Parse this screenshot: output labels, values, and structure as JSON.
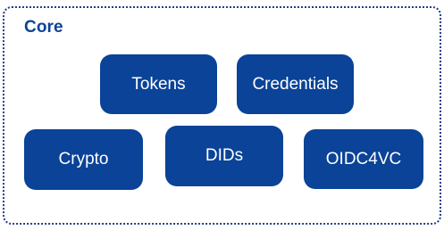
{
  "group": {
    "title": "Core",
    "border_color": "#1e3f86",
    "title_color": "#0b4396"
  },
  "nodes": {
    "tokens": "Tokens",
    "credentials": "Credentials",
    "crypto": "Crypto",
    "dids": "DIDs",
    "oidc4vc": "OIDC4VC"
  },
  "colors": {
    "node_fill": "#0a4397",
    "node_text": "#ffffff"
  }
}
